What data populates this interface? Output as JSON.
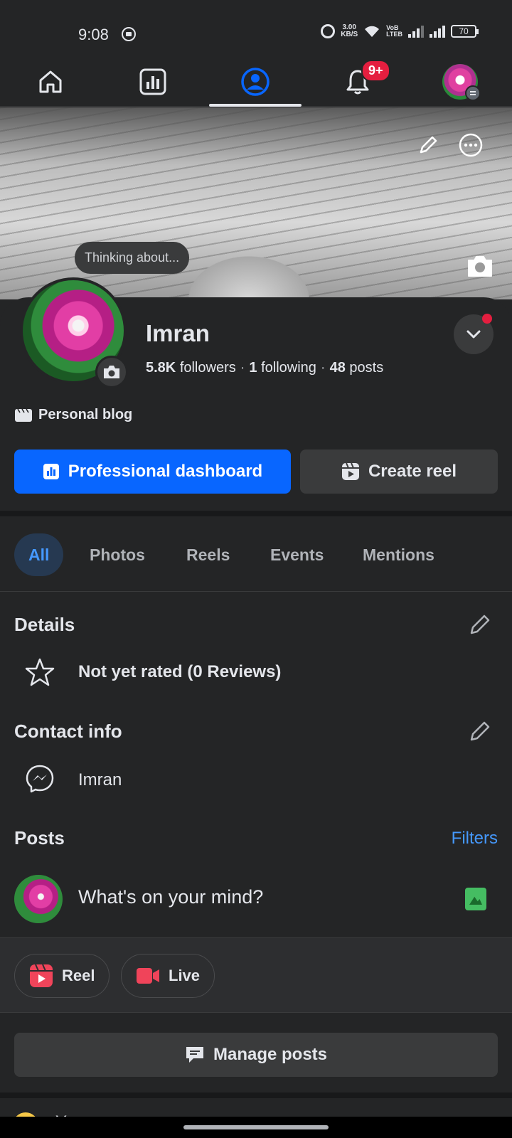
{
  "status_bar": {
    "time": "9:08",
    "speed_value": "3.00",
    "speed_unit": "KB/S",
    "volte_top": "VoB",
    "volte_bottom": "LTEB",
    "battery": "70"
  },
  "top_nav": {
    "items": [
      "home",
      "dashboard",
      "profile",
      "notifications",
      "menu"
    ],
    "active": "profile",
    "notification_badge": "9+"
  },
  "cover": {
    "thinking_bubble": "Thinking about..."
  },
  "profile": {
    "name": "Imran",
    "followers_count": "5.8K",
    "followers_label": "followers",
    "following_count": "1",
    "following_label": "following",
    "posts_count": "48",
    "posts_label": "posts",
    "category": "Personal blog",
    "primary_button": "Professional dashboard",
    "secondary_button": "Create reel"
  },
  "tabs": {
    "items": [
      "All",
      "Photos",
      "Reels",
      "Events",
      "Mentions"
    ],
    "active": "All"
  },
  "details": {
    "title": "Details",
    "rating": "Not yet rated (0 Reviews)"
  },
  "contact": {
    "title": "Contact info",
    "messenger": "Imran"
  },
  "posts": {
    "title": "Posts",
    "filters": "Filters",
    "composer_placeholder": "What's on your mind?",
    "reel_button": "Reel",
    "live_button": "Live",
    "manage_button": "Manage posts",
    "peek_text": "Y"
  },
  "colors": {
    "background": "#242526",
    "accent": "#0866ff",
    "link": "#4599ff",
    "badge": "#e41e3f"
  }
}
